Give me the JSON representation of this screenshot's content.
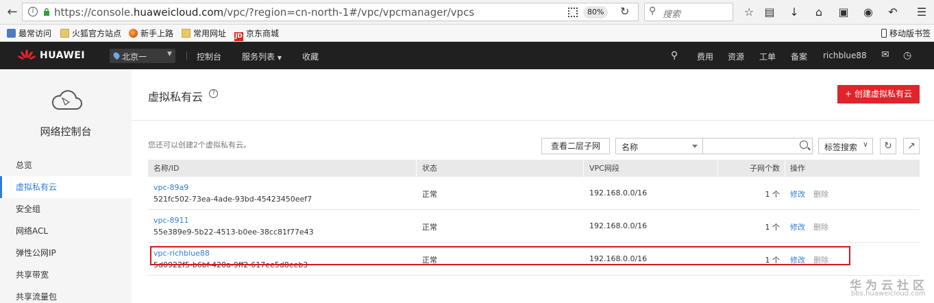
{
  "browser": {
    "url_prefix": "https://console.",
    "url_domain": "huaweicloud.com",
    "url_suffix": "/vpc/?region=cn-north-1#/vpc/vpcmanager/vpcs",
    "zoom": "80%",
    "search_placeholder": "搜索"
  },
  "bookmarks": {
    "items": [
      "最常访问",
      "火狐官方站点",
      "新手上路",
      "常用网址",
      "京东商城"
    ],
    "mobile": "移动版书签"
  },
  "topnav": {
    "brand": "HUAWEI",
    "region": "北京一",
    "links": [
      "控制台",
      "服务列表",
      "收藏"
    ],
    "right_links": [
      "费用",
      "资源",
      "工单",
      "备案"
    ],
    "user": "richblue88"
  },
  "sidebar": {
    "title": "网络控制台",
    "items": [
      {
        "label": "总览"
      },
      {
        "label": "虚拟私有云"
      },
      {
        "label": "安全组"
      },
      {
        "label": "网络ACL"
      },
      {
        "label": "弹性公网IP"
      },
      {
        "label": "共享带宽"
      },
      {
        "label": "共享流量包"
      }
    ]
  },
  "main": {
    "title": "虚拟私有云",
    "create_label": "创建虚拟私有云",
    "quota_text": "您还可以创建2个虚拟私有云。",
    "view_subnet_label": "查看二层子网",
    "filter_select": "名称",
    "tag_search": "标签搜索"
  },
  "table": {
    "columns": [
      "名称/ID",
      "状态",
      "VPC网段",
      "子网个数",
      "操作"
    ],
    "rows": [
      {
        "name": "vpc-89a9",
        "id": "521fc502-73ea-4ade-93bd-45423450eef7",
        "status": "正常",
        "cidr": "192.168.0.0/16",
        "subnets": "1 个",
        "edit": "修改",
        "delete": "删除"
      },
      {
        "name": "vpc-8911",
        "id": "55e389e9-5b22-4513-b0ee-38cc81f77e43",
        "status": "正常",
        "cidr": "192.168.0.0/16",
        "subnets": "1 个",
        "edit": "修改",
        "delete": "删除"
      },
      {
        "name": "vpc-richblue88",
        "id": "5d0922f5-b6bf-420a-9ff2-617ee5d8eeb3",
        "status": "正常",
        "cidr": "192.168.0.0/16",
        "subnets": "1 个",
        "edit": "修改",
        "delete": "删除"
      }
    ]
  },
  "watermark": {
    "title": "华为云社区",
    "url": "bbs.huaweicloud.com"
  },
  "colors": {
    "accent": "#e0242b",
    "link": "#2e7cd6",
    "nav_bg": "#202020"
  }
}
